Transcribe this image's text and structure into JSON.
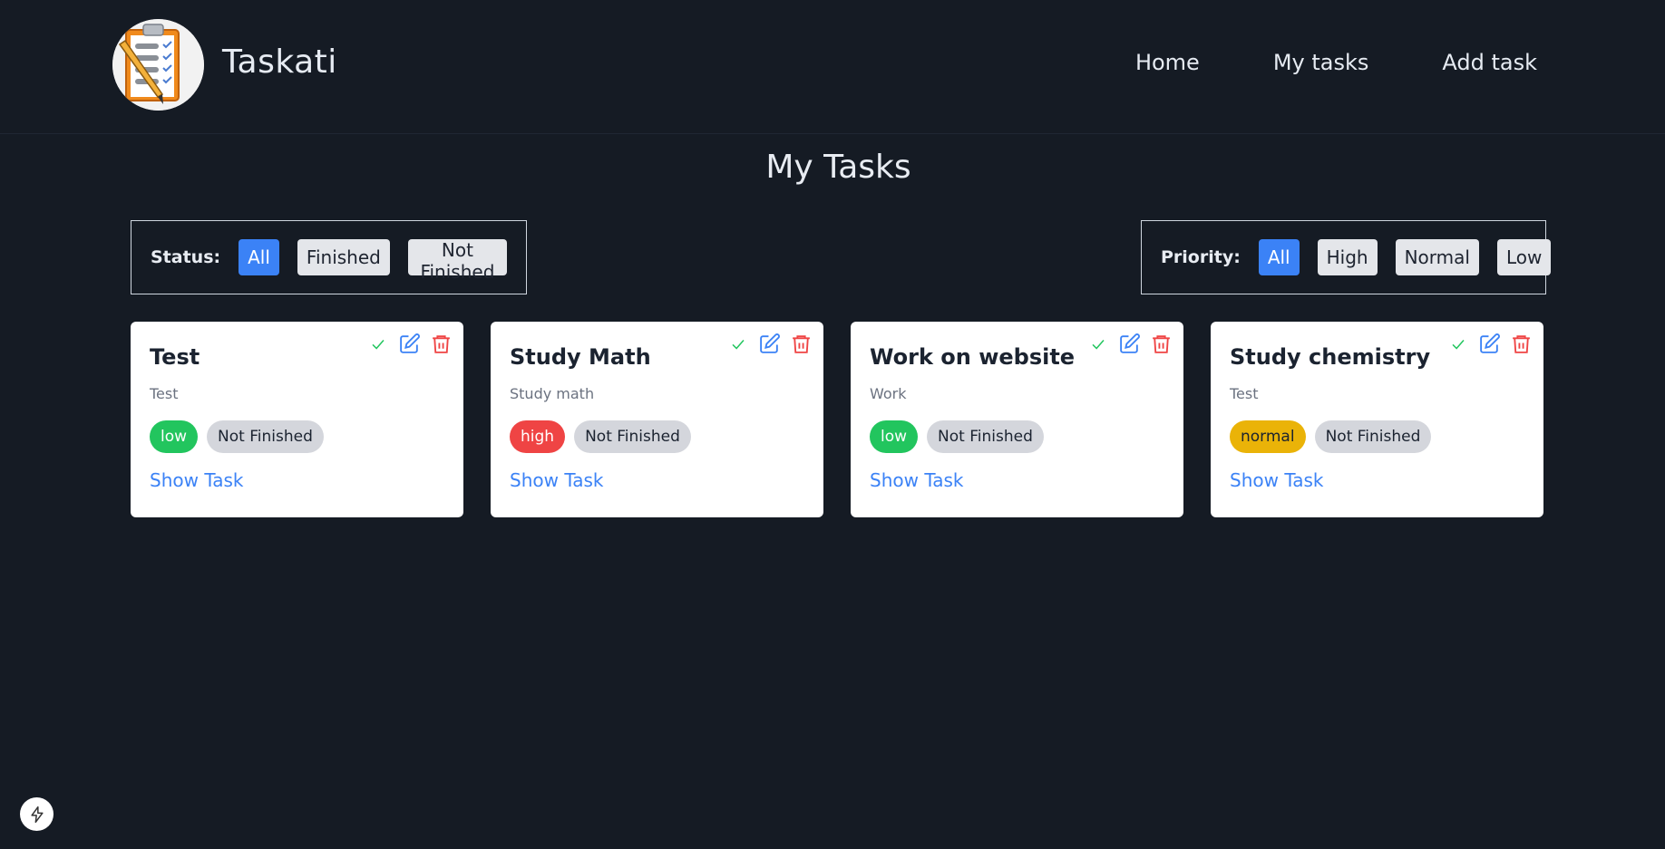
{
  "brand": {
    "name": "Taskati"
  },
  "nav": [
    {
      "label": "Home"
    },
    {
      "label": "My tasks"
    },
    {
      "label": "Add task"
    }
  ],
  "page": {
    "title": "My Tasks"
  },
  "filters": {
    "status": {
      "label": "Status:",
      "options": [
        "All",
        "Finished",
        "Not Finished"
      ],
      "selected": "All"
    },
    "priority": {
      "label": "Priority:",
      "options": [
        "All",
        "High",
        "Normal",
        "Low"
      ],
      "selected": "All"
    }
  },
  "tasks": [
    {
      "title": "Test",
      "description": "Test",
      "priority": "low",
      "status": "Not Finished",
      "link": "Show Task"
    },
    {
      "title": "Study Math",
      "description": "Study math",
      "priority": "high",
      "status": "Not Finished",
      "link": "Show Task"
    },
    {
      "title": "Work on website",
      "description": "Work",
      "priority": "low",
      "status": "Not Finished",
      "link": "Show Task"
    },
    {
      "title": "Study chemistry",
      "description": "Test",
      "priority": "normal",
      "status": "Not Finished",
      "link": "Show Task"
    }
  ],
  "colors": {
    "background": "#151b24",
    "accent": "#3b82f6",
    "low": "#22c55e",
    "high": "#ef4444",
    "normal": "#eab308",
    "delete": "#ef4444",
    "check": "#22c55e"
  },
  "icons": {
    "card_actions": [
      "check-icon",
      "edit-icon",
      "trash-icon"
    ],
    "floating": "bolt-icon"
  }
}
